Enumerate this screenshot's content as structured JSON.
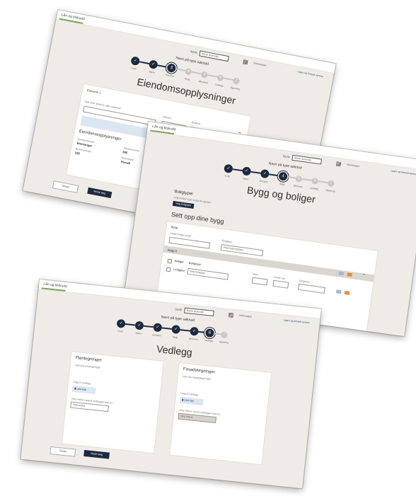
{
  "brand": "Lån og tilskudd",
  "language": {
    "label": "Språk",
    "value": "Norsk (bokmål)"
  },
  "header": {
    "info": "Informasjon",
    "save": "Lagre og fortsett senere"
  },
  "case_title": "Navn på type søknad",
  "steps": [
    "Profil",
    "Søker",
    "Eiendom",
    "Bygg",
    "Økonomi",
    "Vedlegg",
    "Signering"
  ],
  "screens": {
    "eiendom": {
      "title": "Eiendomsopplysninger",
      "property_heading": "Eiendom 1",
      "search_label": "Søk etter adresse eller matrikkel",
      "unit_label": "Gårdsnr",
      "unit2_label": "Bruksnr",
      "info_heading": "Eiendomsopplysninger",
      "municipality_label": "Kommunenavn",
      "municipality_value": "Bremanger",
      "number_label": "Gårdsnummer",
      "number_value": "845",
      "plot_label": "Bruksnummer",
      "plot_value": "335",
      "extra_label": "Bruksareal",
      "extra_value": "Parsell"
    },
    "bygg": {
      "title": "Bygg og boliger",
      "housing_heading": "Boligtyper",
      "housing_sub": "Velg hvilken type bolig det gjelder",
      "housing_button": "Velg boligtype",
      "setup_heading": "Sett opp dine bygg",
      "building_label": "Bygg",
      "owner_label": "Antall boliger totalt",
      "type_label": "Byggtype",
      "type_value": "Velg bygningstype",
      "building_name": "Bygg A",
      "rows_label": "Boliger",
      "unit_label": "Bolig",
      "apartment_label": "Leilighet",
      "housing_type_label": "Boligtype",
      "housing_type_value": "Velg boligtype",
      "area_label": "BRA",
      "count_label": "Antall rom",
      "price_label": "Salgspris"
    },
    "vedlegg": {
      "title": "Vedlegg",
      "left_heading": "Plantegninger",
      "left_sub": "Last opp plantegninger",
      "left_upload_label": "Legg til vedlegg",
      "left_upload_button": "Last opp",
      "left_status_label": "Velg hvilken status vedlegget skal ha",
      "left_status_value": "Velg status",
      "right_heading": "Fasadetegninger",
      "right_sub": "Last opp fasadetegninger",
      "right_upload_label": "Legg til vedlegg",
      "right_upload_button": "Last opp",
      "right_status_label": "Velg hvilken status vedlegget skal ha",
      "right_status_value": "Velg status"
    }
  },
  "nav": {
    "back": "Tilbake",
    "next": "Neste steg"
  }
}
